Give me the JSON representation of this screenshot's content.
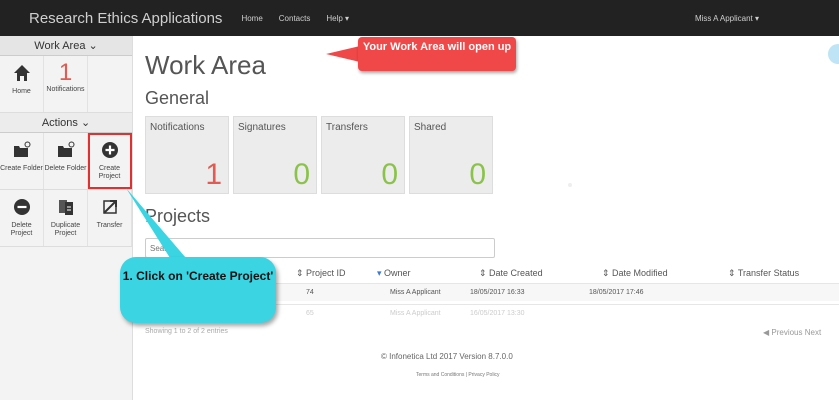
{
  "topbar": {
    "brand": "Research Ethics Applications",
    "nav": [
      "Home",
      "Contacts",
      "Help ▾"
    ],
    "user": "Miss A Applicant ▾"
  },
  "sidebar": {
    "work_area_label": "Work Area ⌄",
    "home_label": "Home",
    "notifications_label": "Notifications",
    "notifications_count": "1",
    "actions_label": "Actions ⌄",
    "actions": [
      {
        "label": "Create Folder",
        "icon": "folder-add-icon"
      },
      {
        "label": "Delete Folder",
        "icon": "folder-delete-icon"
      },
      {
        "label": "Create Project",
        "icon": "plus-circle-icon"
      },
      {
        "label": "Delete Project",
        "icon": "minus-circle-icon"
      },
      {
        "label": "Duplicate Project",
        "icon": "duplicate-icon"
      },
      {
        "label": "Transfer",
        "icon": "transfer-icon"
      }
    ]
  },
  "main": {
    "title": "Work Area",
    "general_title": "General",
    "tiles": [
      {
        "label": "Notifications",
        "count": "1",
        "color": "#e25a52"
      },
      {
        "label": "Signatures",
        "count": "0",
        "color": "#8bc34a"
      },
      {
        "label": "Transfers",
        "count": "0",
        "color": "#8bc34a"
      },
      {
        "label": "Shared",
        "count": "0",
        "color": "#8bc34a"
      }
    ],
    "projects_title": "Projects",
    "search_placeholder": "Search",
    "columns": [
      "Project ID",
      "Owner",
      "Date Created",
      "Date Modified",
      "Transfer Status"
    ],
    "rows": [
      {
        "id": "74",
        "owner": "Miss A Applicant",
        "created": "18/05/2017 16:33",
        "modified": "18/05/2017 17:46",
        "status": ""
      },
      {
        "id": "65",
        "owner": "Miss A Applicant",
        "created": "16/05/2017 13:30",
        "modified": "",
        "status": ""
      }
    ],
    "showing": "Showing 1 to 2 of 2 entries",
    "pager": "◀ Previous  Next",
    "footer_version": "© Infonetica Ltd 2017 Version 8.7.0.0",
    "footer_links": "Terms and Conditions | Privacy Policy"
  },
  "callouts": {
    "work_area": "Your Work Area will open up",
    "create_project": "1. Click on 'Create Project'"
  },
  "colors": {
    "accent_red": "#f04848",
    "callout_teal": "#3ad4e3",
    "topbar": "#222222"
  }
}
